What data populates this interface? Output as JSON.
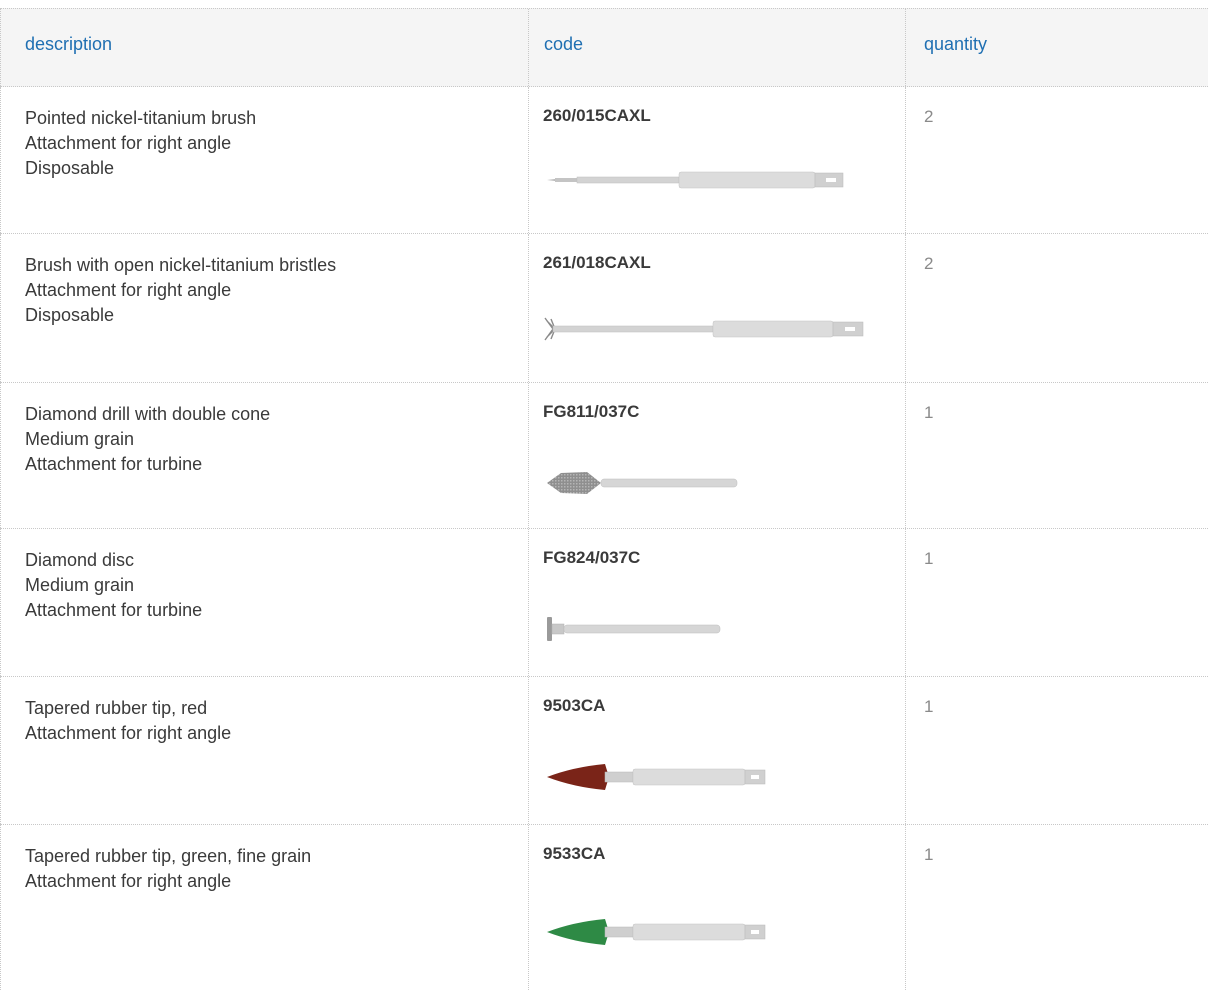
{
  "table": {
    "headers": {
      "description": "description",
      "code": "code",
      "quantity": "quantity"
    },
    "rows": [
      {
        "description": [
          "Pointed nickel-titanium brush",
          "Attachment for right angle",
          "Disposable"
        ],
        "code": "260/015CAXL",
        "quantity": "2",
        "tool_icon": "pointed-brush-icon"
      },
      {
        "description": [
          "Brush with open nickel-titanium bristles",
          "Attachment for right angle",
          "Disposable"
        ],
        "code": "261/018CAXL",
        "quantity": "2",
        "tool_icon": "open-bristle-brush-icon"
      },
      {
        "description": [
          "Diamond drill with double cone",
          "Medium grain",
          "Attachment for turbine"
        ],
        "code": "FG811/037C",
        "quantity": "1",
        "tool_icon": "diamond-drill-icon"
      },
      {
        "description": [
          "Diamond disc",
          "Medium grain",
          "Attachment for turbine"
        ],
        "code": "FG824/037C",
        "quantity": "1",
        "tool_icon": "diamond-disc-icon"
      },
      {
        "description": [
          "Tapered rubber tip, red",
          "Attachment for right angle"
        ],
        "code": "9503CA",
        "quantity": "1",
        "tool_icon": "red-rubber-tip-icon"
      },
      {
        "description": [
          "Tapered rubber tip, green, fine grain",
          "Attachment for right angle"
        ],
        "code": "9533CA",
        "quantity": "1",
        "tool_icon": "green-rubber-tip-icon"
      }
    ]
  },
  "colors": {
    "header_text": "#1f6fb2",
    "red_tip": "#7a2418",
    "green_tip": "#2e8a45"
  }
}
